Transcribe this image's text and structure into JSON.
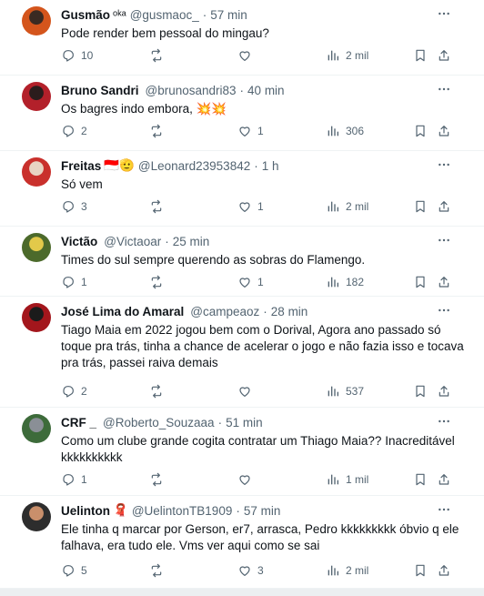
{
  "tweets": [
    {
      "name": "Gusmão",
      "badge": "ᵒᵏᵃ",
      "handle": "@gusmaoc_",
      "time": "57 min",
      "text": "Pode render bem pessoal do mingau?",
      "replies": "10",
      "retweets": "",
      "likes": "",
      "views": "2 mil",
      "avatar_colors": [
        "#d4551c",
        "#3a2a22"
      ]
    },
    {
      "name": "Bruno Sandri",
      "badge": "",
      "handle": "@brunosandri83",
      "time": "40 min",
      "text": "Os bagres indo embora, 💥💥",
      "replies": "2",
      "retweets": "",
      "likes": "1",
      "views": "306",
      "avatar_colors": [
        "#b3202a",
        "#2b1c1c"
      ]
    },
    {
      "name": "Freitas",
      "badge": "🇮🇩🫡",
      "handle": "@Leonard23953842",
      "time": "1 h",
      "text": "Só vem",
      "replies": "3",
      "retweets": "",
      "likes": "1",
      "views": "2 mil",
      "avatar_colors": [
        "#c9302c",
        "#e8d3c2"
      ]
    },
    {
      "name": "Victão",
      "badge": "",
      "handle": "@Victaoar",
      "time": "25 min",
      "text": "Times do sul sempre querendo as sobras do Flamengo.",
      "replies": "1",
      "retweets": "",
      "likes": "1",
      "views": "182",
      "avatar_colors": [
        "#4c6a2b",
        "#e2c94a"
      ]
    },
    {
      "name": "José Lima do Amaral",
      "badge": "",
      "handle": "@campeaoz",
      "time": "28 min",
      "text": "Tiago Maia em 2022 jogou bem com o Dorival, Agora ano passado só toque pra trás, tinha a chance de acelerar o jogo e não fazia isso e tocava pra trás, passei raiva demais",
      "replies": "2",
      "retweets": "",
      "likes": "",
      "views": "537",
      "avatar_colors": [
        "#a3161c",
        "#1b1b1b"
      ]
    },
    {
      "name": "CRF _",
      "badge": "",
      "handle": "@Roberto_Souzaaa",
      "time": "51 min",
      "text": "Como um clube grande cogita contratar um Thiago Maia?? Inacreditável kkkkkkkkkk",
      "replies": "1",
      "retweets": "",
      "likes": "",
      "views": "1 mil",
      "avatar_colors": [
        "#3d6b3a",
        "#8a8f96"
      ]
    },
    {
      "name": "Uelinton",
      "badge": "🧣",
      "handle": "@UelintonTB1909",
      "time": "57 min",
      "text": "Ele tinha q marcar por Gerson, er7, arrasca, Pedro kkkkkkkkk óbvio q ele falhava, era tudo ele. Vms ver aqui como se sai",
      "replies": "5",
      "retweets": "",
      "likes": "3",
      "views": "2 mil",
      "avatar_colors": [
        "#2d2d2d",
        "#c98f6b"
      ]
    }
  ],
  "icons": {
    "reply": "reply-icon",
    "retweet": "retweet-icon",
    "like": "like-icon",
    "views": "views-icon",
    "bookmark": "bookmark-icon",
    "share": "share-icon",
    "more": "more-icon"
  }
}
